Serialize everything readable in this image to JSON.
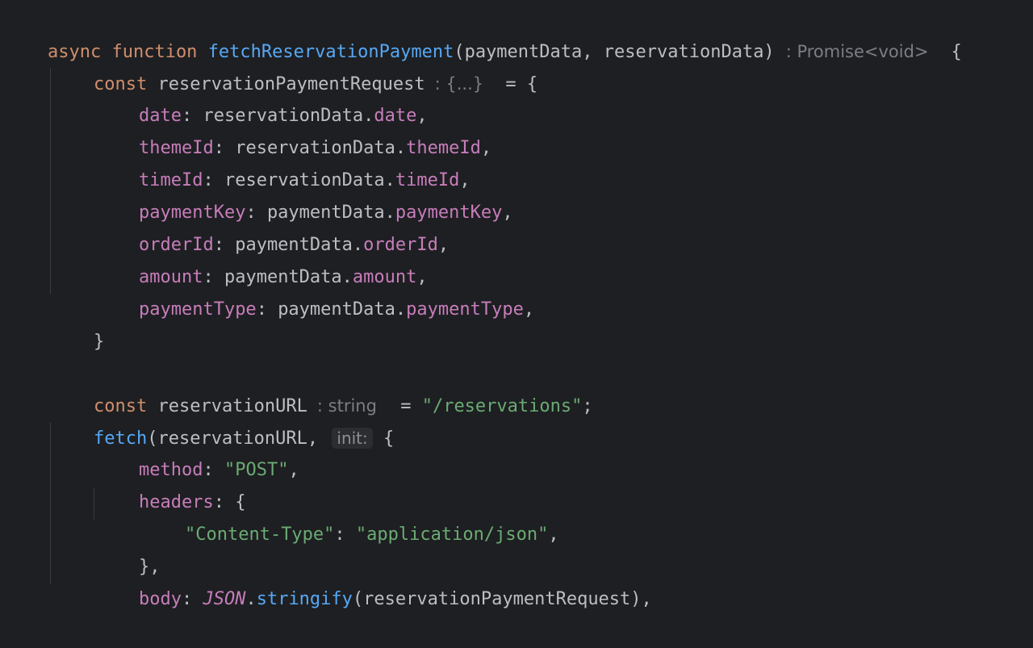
{
  "code": {
    "l1": {
      "async": "async",
      "function": "function",
      "name": "fetchReservationPayment",
      "params": "(paymentData, reservationData)",
      "hint": ": Promise<void>",
      "brace": "{"
    },
    "l2": {
      "const": "const",
      "name": "reservationPaymentRequest",
      "hint": ": {...}",
      "assign": " = {"
    },
    "l3": {
      "key": "date",
      "colon": ": ",
      "obj": "reservationData.",
      "prop": "date",
      "comma": ","
    },
    "l4": {
      "key": "themeId",
      "colon": ": ",
      "obj": "reservationData.",
      "prop": "themeId",
      "comma": ","
    },
    "l5": {
      "key": "timeId",
      "colon": ": ",
      "obj": "reservationData.",
      "prop": "timeId",
      "comma": ","
    },
    "l6": {
      "key": "paymentKey",
      "colon": ": ",
      "obj": "paymentData.",
      "prop": "paymentKey",
      "comma": ","
    },
    "l7": {
      "key": "orderId",
      "colon": ": ",
      "obj": "paymentData.",
      "prop": "orderId",
      "comma": ","
    },
    "l8": {
      "key": "amount",
      "colon": ": ",
      "obj": "paymentData.",
      "prop": "amount",
      "comma": ","
    },
    "l9": {
      "key": "paymentType",
      "colon": ": ",
      "obj": "paymentData.",
      "prop": "paymentType",
      "comma": ","
    },
    "l10": {
      "brace": "}"
    },
    "l12": {
      "const": "const",
      "name": "reservationURL",
      "hint": ": string",
      "assign": " = ",
      "value": "\"/reservations\"",
      "semi": ";"
    },
    "l13": {
      "fn": "fetch",
      "open": "(reservationURL, ",
      "hint": "init:",
      "brace": " {"
    },
    "l14": {
      "key": "method",
      "colon": ": ",
      "value": "\"POST\"",
      "comma": ","
    },
    "l15": {
      "key": "headers",
      "colon": ": ",
      "brace": "{"
    },
    "l16": {
      "key": "\"Content-Type\"",
      "colon": ": ",
      "value": "\"application/json\"",
      "comma": ","
    },
    "l17": {
      "close": "},"
    },
    "l18": {
      "key": "body",
      "colon": ": ",
      "json": "JSON",
      "dot": ".",
      "method": "stringify",
      "args": "(reservationPaymentRequest),",
      "tail": ""
    }
  },
  "colors": {
    "background": "#1e1f22",
    "keyword": "#cf8e6d",
    "function": "#56a8f5",
    "property": "#c77dbb",
    "string": "#6aab73",
    "text": "#bcbec4",
    "hint": "#7a7e85"
  }
}
